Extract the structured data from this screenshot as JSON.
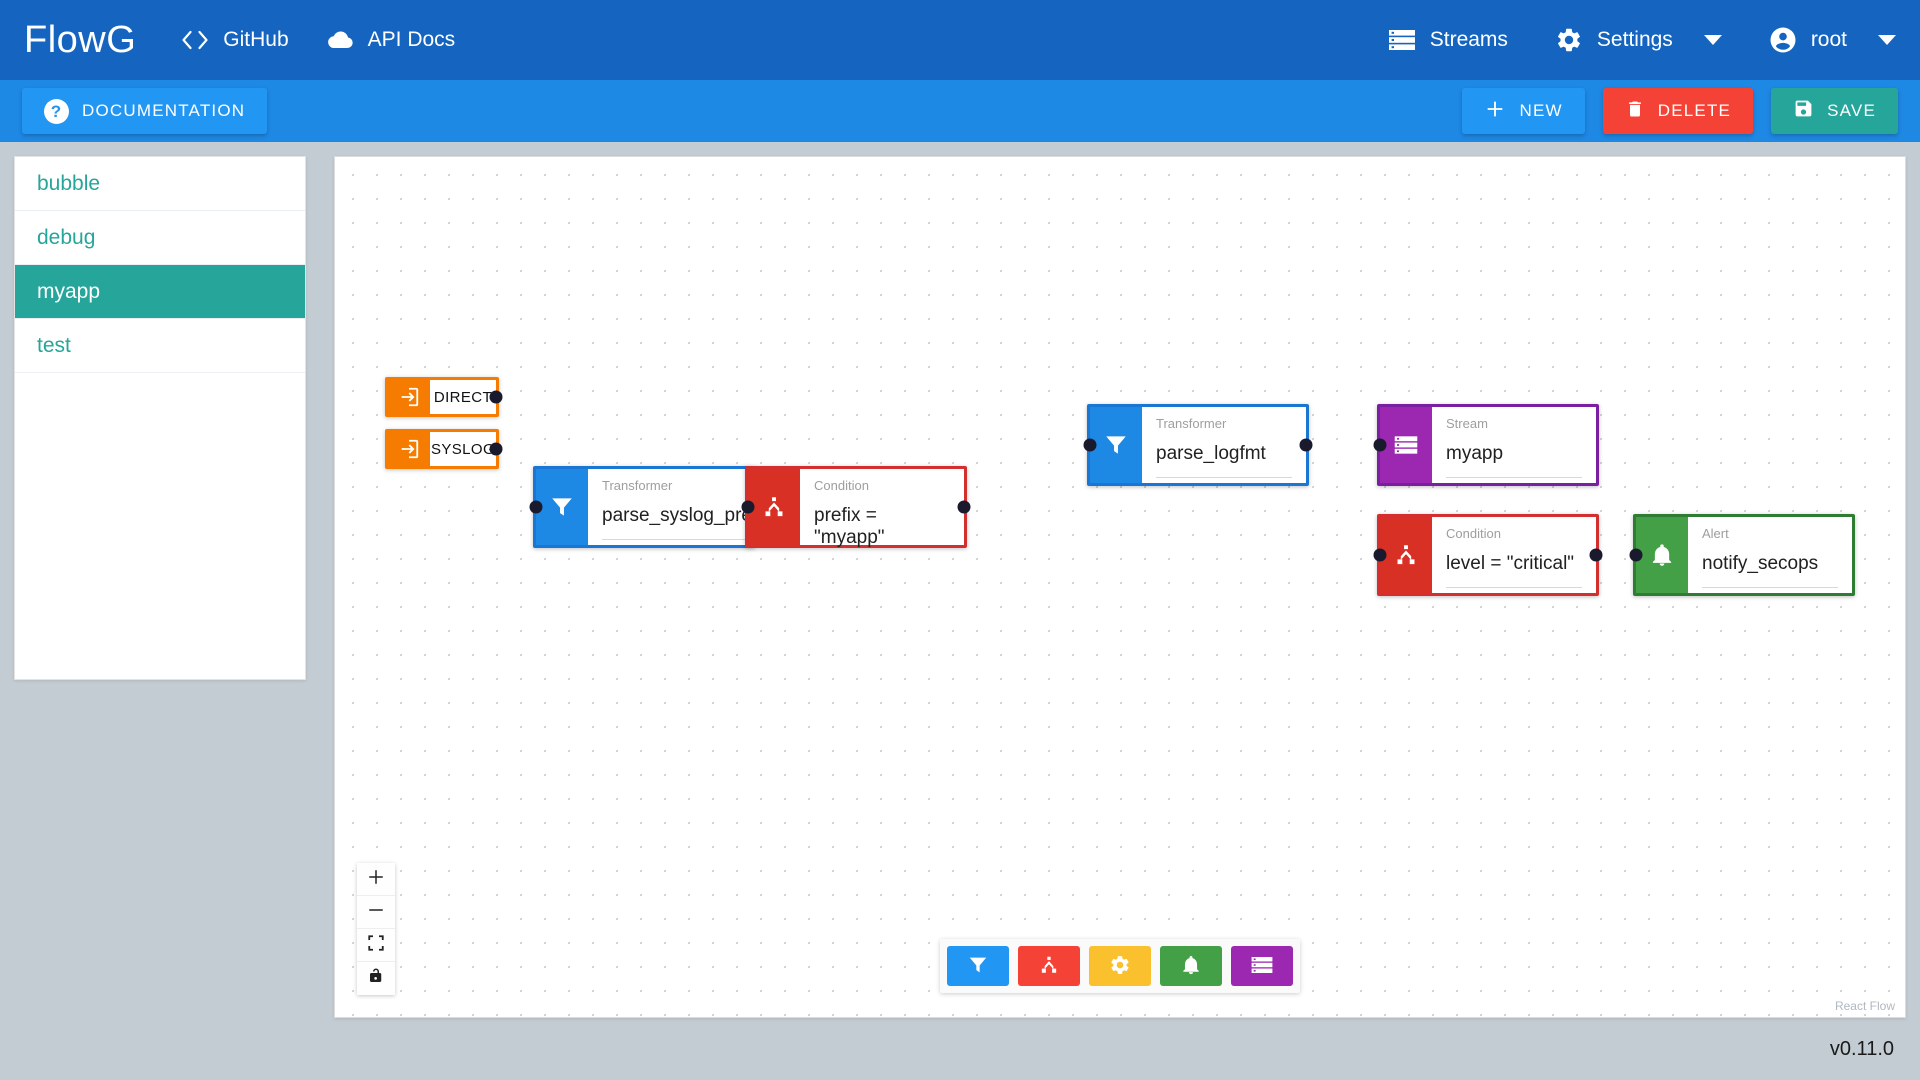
{
  "navbar": {
    "brand": "FlowG",
    "links": [
      {
        "label": "GitHub",
        "icon": "code-brackets-icon"
      },
      {
        "label": "API Docs",
        "icon": "cloud-icon"
      }
    ],
    "right": [
      {
        "label": "Streams",
        "icon": "database-icon"
      },
      {
        "label": "Settings",
        "icon": "gear-icon"
      },
      {
        "label": "root",
        "icon": "account-circle-icon"
      }
    ],
    "background": "#1565c0"
  },
  "toolbar": {
    "documentation_label": "DOCUMENTATION",
    "documentation_icon": "help-icon",
    "new_label": "NEW",
    "new_icon": "plus-icon",
    "delete_label": "DELETE",
    "delete_icon": "trash-icon",
    "save_label": "SAVE",
    "save_icon": "floppy-disk-icon",
    "background": "#1e88e5",
    "new_color": "#2196f3",
    "delete_color": "#f44336",
    "save_color": "#26a69a"
  },
  "sidebar": {
    "items": [
      {
        "label": "bubble",
        "active": false
      },
      {
        "label": "debug",
        "active": false
      },
      {
        "label": "myapp",
        "active": true
      },
      {
        "label": "test",
        "active": false
      }
    ],
    "active_color": "#26a69a",
    "link_color": "#26a69a"
  },
  "canvas": {
    "attribution": "React Flow",
    "zoom_controls": [
      {
        "name": "zoom-in",
        "icon": "plus-icon"
      },
      {
        "name": "zoom-out",
        "icon": "minus-icon"
      },
      {
        "name": "fit-view",
        "icon": "fit-screen-icon"
      },
      {
        "name": "toggle-interactivity",
        "icon": "lock-open-icon"
      }
    ],
    "palette": [
      {
        "name": "add-transformer",
        "icon": "funnel-icon",
        "color": "#2196f3"
      },
      {
        "name": "add-condition",
        "icon": "fork-icon",
        "color": "#f44336"
      },
      {
        "name": "add-switch",
        "icon": "gear-icon",
        "color": "#fbc02d"
      },
      {
        "name": "add-alert",
        "icon": "bell-icon",
        "color": "#43a047"
      },
      {
        "name": "add-stream",
        "icon": "database-icon",
        "color": "#9c27b0"
      }
    ],
    "nodes": [
      {
        "id": "direct",
        "type": "source",
        "label": "DIRECT",
        "icon": "login-icon",
        "color": "#f57c00"
      },
      {
        "id": "syslog",
        "type": "source",
        "label": "SYSLOG",
        "icon": "login-icon",
        "color": "#f57c00"
      },
      {
        "id": "parse_syslog_prefix",
        "type": "Transformer",
        "kind": "Transformer",
        "name": "parse_syslog_prefix",
        "icon": "funnel-icon",
        "color": "#1e88e5"
      },
      {
        "id": "prefix_cond",
        "type": "Condition",
        "kind": "Condition",
        "name": "prefix = \"myapp\"",
        "icon": "fork-icon",
        "color": "#d93025"
      },
      {
        "id": "parse_logfmt",
        "type": "Transformer",
        "kind": "Transformer",
        "name": "parse_logfmt",
        "icon": "funnel-icon",
        "color": "#1e88e5"
      },
      {
        "id": "stream_myapp",
        "type": "Stream",
        "kind": "Stream",
        "name": "myapp",
        "icon": "database-icon",
        "color": "#9c27b0"
      },
      {
        "id": "level_cond",
        "type": "Condition",
        "kind": "Condition",
        "name": "level = \"critical\"",
        "icon": "fork-icon",
        "color": "#d93025"
      },
      {
        "id": "notify_secops",
        "type": "Alert",
        "kind": "Alert",
        "name": "notify_secops",
        "icon": "bell-icon",
        "color": "#43a047"
      }
    ]
  },
  "footer": {
    "version": "v0.11.0"
  }
}
